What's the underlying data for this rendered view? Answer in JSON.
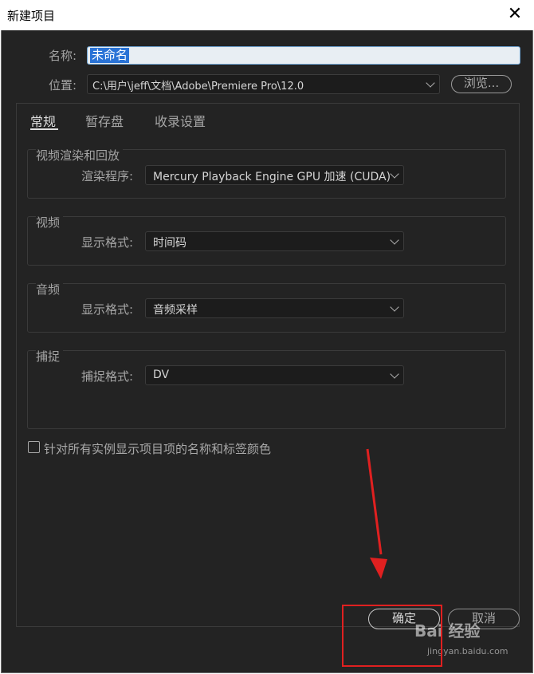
{
  "window": {
    "title": "新建项目",
    "close_glyph": "✕"
  },
  "name_field": {
    "label": "名称:",
    "value": "未命名"
  },
  "location": {
    "label": "位置:",
    "value": "C:\\用户\\jeff\\文档\\Adobe\\Premiere Pro\\12.0",
    "browse_label": "浏览..."
  },
  "tabs": [
    {
      "label": "常规",
      "active": true
    },
    {
      "label": "暂存盘",
      "active": false
    },
    {
      "label": "收录设置",
      "active": false
    }
  ],
  "groups": {
    "video_render": {
      "title": "视频渲染和回放",
      "row_label": "渲染程序:",
      "value": "Mercury Playback Engine GPU 加速 (CUDA)"
    },
    "video": {
      "title": "视频",
      "row_label": "显示格式:",
      "value": "时间码"
    },
    "audio": {
      "title": "音频",
      "row_label": "显示格式:",
      "value": "音频采样"
    },
    "capture": {
      "title": "捕捉",
      "row_label": "捕捉格式:",
      "value": "DV"
    }
  },
  "checkbox": {
    "label": "针对所有实例显示项目项的名称和标签颜色",
    "checked": false
  },
  "buttons": {
    "ok": "确定",
    "cancel": "取消"
  },
  "watermark": {
    "text": "Bai 经验",
    "sub": "jingyan.baidu.com"
  },
  "colors": {
    "dialog_bg": "#232323",
    "selection": "#2a73d6",
    "annotation": "#e02020"
  }
}
